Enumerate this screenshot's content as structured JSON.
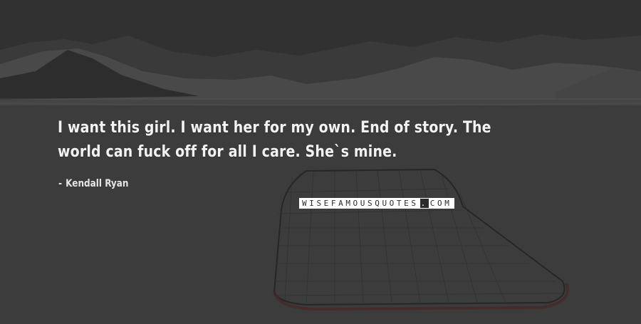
{
  "quote": {
    "text": "I want this girl. I want her for my own. End of story. The world can fuck off for all I care. She`s mine.",
    "author": "Kendall Ryan",
    "author_prefix": "-"
  },
  "watermark": {
    "left": "WISEFAMOUSQUOTES",
    "dot": ".",
    "right": "COM"
  },
  "colors": {
    "background": "#3a3a3a",
    "text": "#f2f2f2",
    "watermark_bg": "#ffffff"
  }
}
